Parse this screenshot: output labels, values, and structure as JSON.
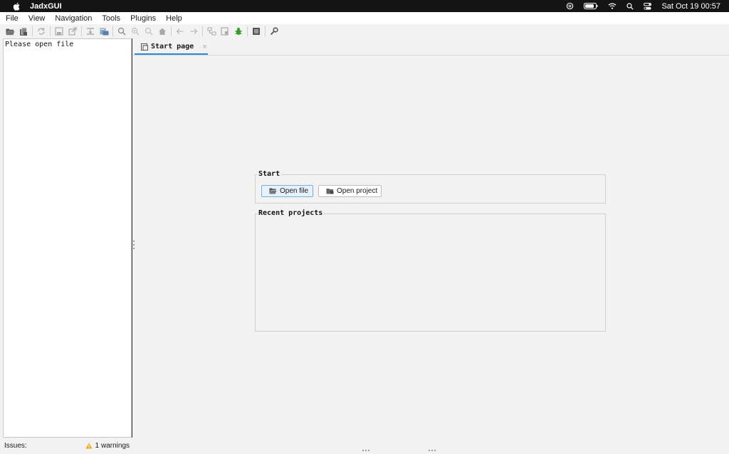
{
  "mac_menubar": {
    "app_name": "JadxGUI",
    "clock": "Sat Oct 19  00:57"
  },
  "menu": {
    "items": [
      "File",
      "View",
      "Navigation",
      "Tools",
      "Plugins",
      "Help"
    ]
  },
  "toolbar": {
    "icons": [
      "open-file-icon",
      "add-files-icon",
      "sync-icon",
      "save-all-icon",
      "export-icon",
      "flatten-packages-icon",
      "sync-with-editor-icon",
      "search-icon",
      "find-class-icon",
      "find-usage-icon",
      "home-icon",
      "back-arrow-icon",
      "forward-arrow-icon",
      "deobfuscation-icon",
      "quark-icon",
      "debug-icon",
      "log-viewer-icon",
      "preferences-wrench-icon"
    ]
  },
  "left_panel": {
    "hint": "Please open file"
  },
  "tabs": [
    {
      "label": "Start page",
      "close": "×"
    }
  ],
  "start_group": {
    "title": "Start",
    "open_file_label": "Open file",
    "open_project_label": "Open project"
  },
  "recent_group": {
    "title": "Recent projects"
  },
  "status": {
    "issues_label": "Issues:",
    "warnings_label": "1 warnings"
  },
  "colors": {
    "accent": "#2f86d6",
    "warning": "#f0a81c",
    "debug": "#3a9a2e"
  }
}
